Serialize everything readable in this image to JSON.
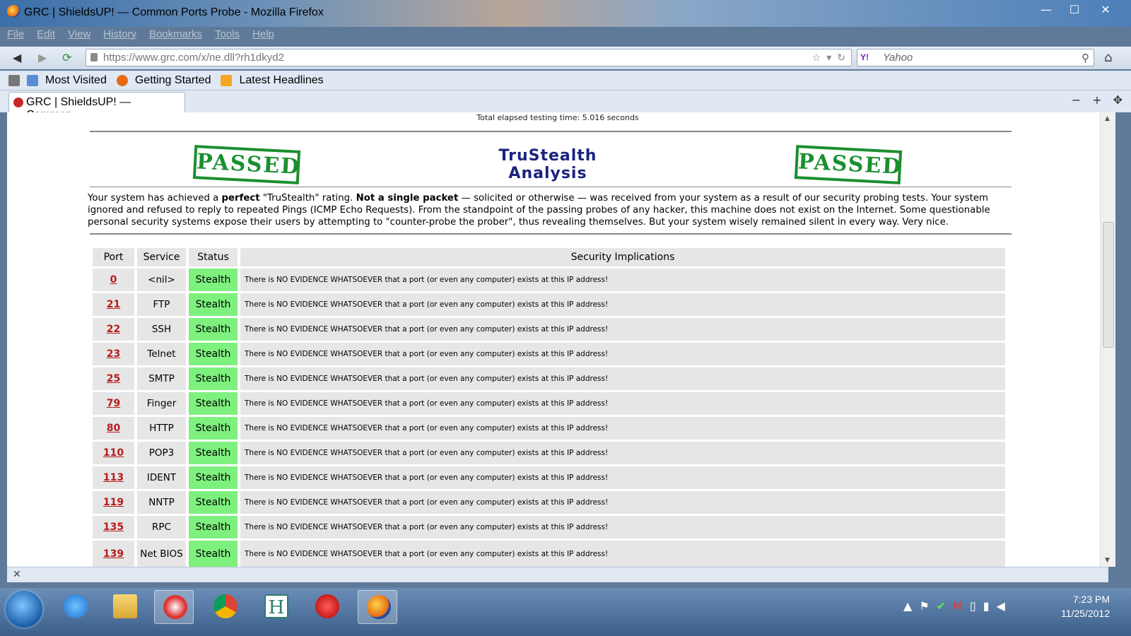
{
  "window": {
    "title": "GRC | ShieldsUP! — Common Ports Probe   - Mozilla Firefox",
    "minimize": "—",
    "maximize": "☐",
    "close": "✕"
  },
  "menu": [
    "File",
    "Edit",
    "View",
    "History",
    "Bookmarks",
    "Tools",
    "Help"
  ],
  "nav": {
    "url": "https://www.grc.com/x/ne.dll?rh1dkyd2",
    "search_placeholder": "Yahoo",
    "yahoo_label": "Y!"
  },
  "bookmarks": [
    "Most Visited",
    "Getting Started",
    "Latest Headlines"
  ],
  "tab": {
    "label": "GRC | ShieldsUP! — Common..."
  },
  "page": {
    "elapsed": "Total elapsed testing time: 5.016 seconds",
    "passed_label": "PASSED",
    "trustealth_line1": "TruStealth",
    "trustealth_line2": "Analysis",
    "summary": {
      "p1": "Your system has achieved a ",
      "b1": "perfect",
      "p2": " \"TruStealth\" rating. ",
      "b2": "Not a single packet",
      "p3": " — solicited or otherwise — was received from your system as a result of our security probing tests. Your system ignored and refused to reply to repeated Pings (ICMP Echo Requests). From the standpoint of the passing probes of any hacker, this machine does not exist on the Internet. Some questionable personal security systems expose their users by attempting to \"counter-probe the prober\", thus revealing themselves. But your system wisely remained silent in every way. Very nice."
    },
    "table": {
      "headers": [
        "Port",
        "Service",
        "Status",
        "Security Implications"
      ],
      "rows": [
        {
          "port": "0",
          "service": "<nil>",
          "status": "Stealth",
          "impl": "There is NO EVIDENCE WHATSOEVER that a port (or even any computer) exists at this IP address!"
        },
        {
          "port": "21",
          "service": "FTP",
          "status": "Stealth",
          "impl": "There is NO EVIDENCE WHATSOEVER that a port (or even any computer) exists at this IP address!"
        },
        {
          "port": "22",
          "service": "SSH",
          "status": "Stealth",
          "impl": "There is NO EVIDENCE WHATSOEVER that a port (or even any computer) exists at this IP address!"
        },
        {
          "port": "23",
          "service": "Telnet",
          "status": "Stealth",
          "impl": "There is NO EVIDENCE WHATSOEVER that a port (or even any computer) exists at this IP address!"
        },
        {
          "port": "25",
          "service": "SMTP",
          "status": "Stealth",
          "impl": "There is NO EVIDENCE WHATSOEVER that a port (or even any computer) exists at this IP address!"
        },
        {
          "port": "79",
          "service": "Finger",
          "status": "Stealth",
          "impl": "There is NO EVIDENCE WHATSOEVER that a port (or even any computer) exists at this IP address!"
        },
        {
          "port": "80",
          "service": "HTTP",
          "status": "Stealth",
          "impl": "There is NO EVIDENCE WHATSOEVER that a port (or even any computer) exists at this IP address!"
        },
        {
          "port": "110",
          "service": "POP3",
          "status": "Stealth",
          "impl": "There is NO EVIDENCE WHATSOEVER that a port (or even any computer) exists at this IP address!"
        },
        {
          "port": "113",
          "service": "IDENT",
          "status": "Stealth",
          "impl": "There is NO EVIDENCE WHATSOEVER that a port (or even any computer) exists at this IP address!"
        },
        {
          "port": "119",
          "service": "NNTP",
          "status": "Stealth",
          "impl": "There is NO EVIDENCE WHATSOEVER that a port (or even any computer) exists at this IP address!"
        },
        {
          "port": "135",
          "service": "RPC",
          "status": "Stealth",
          "impl": "There is NO EVIDENCE WHATSOEVER that a port (or even any computer) exists at this IP address!"
        },
        {
          "port": "139",
          "service": "Net BIOS",
          "status": "Stealth",
          "impl": "There is NO EVIDENCE WHATSOEVER that a port (or even any computer) exists at this IP address!"
        }
      ]
    }
  },
  "statusbar": {
    "close": "✕"
  },
  "taskbar": {
    "apps": [
      "start-orb",
      "internet-explorer",
      "file-explorer",
      "snipping-tool",
      "chrome",
      "h-app",
      "pokerstars",
      "firefox"
    ],
    "time": "7:23 PM",
    "date": "11/25/2012"
  },
  "colors": {
    "stealth_green": "#7ef07e",
    "port_link_red": "#b71c1c",
    "stamp_green": "#1b8f2f",
    "trustealth_blue": "#1a237e"
  }
}
